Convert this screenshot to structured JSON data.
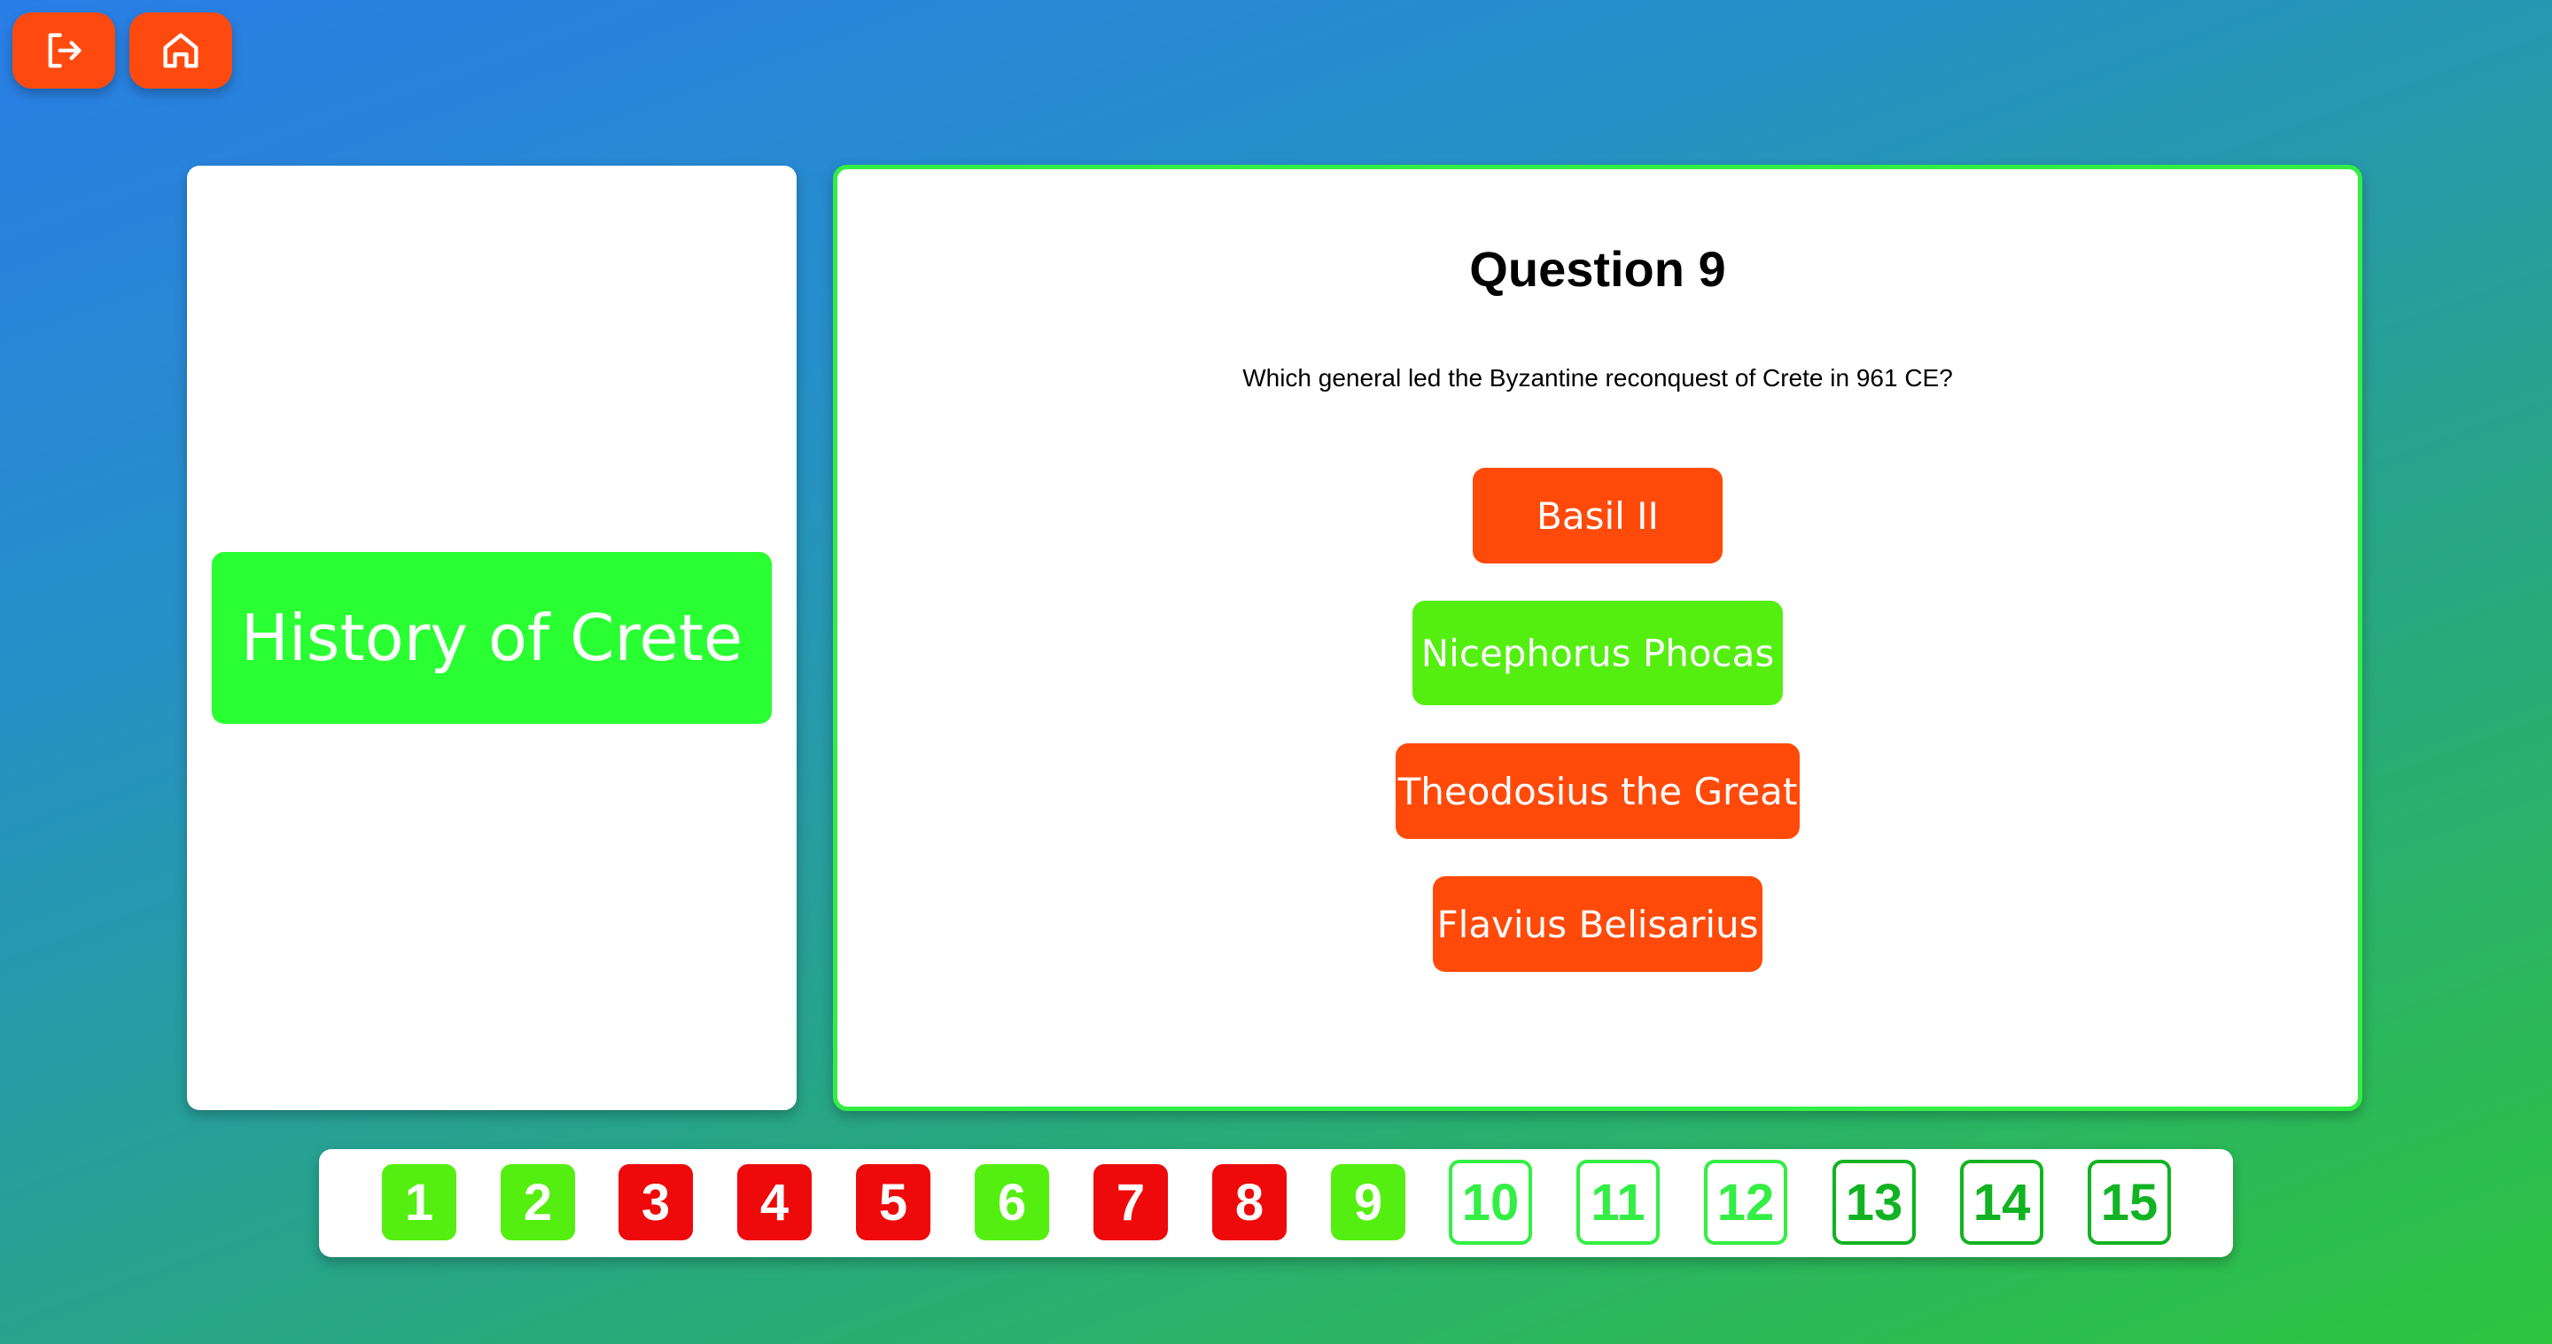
{
  "nav": {
    "exit_icon": "logout-icon",
    "home_icon": "home-icon"
  },
  "topic": {
    "title": "History of Crete"
  },
  "question": {
    "title": "Question 9",
    "text": "Which general led the Byzantine reconquest of Crete in 961 CE?",
    "answers": [
      {
        "label": "Basil II",
        "color": "#ff4a0a"
      },
      {
        "label": "Nicephorus Phocas",
        "color": "#55ee11"
      },
      {
        "label": "Theodosius the Great",
        "color": "#ff4a0a"
      },
      {
        "label": "Flavius Belisarius",
        "color": "#ff4a0a"
      }
    ]
  },
  "progress": {
    "items": [
      {
        "label": "1",
        "status": "correct"
      },
      {
        "label": "2",
        "status": "correct"
      },
      {
        "label": "3",
        "status": "wrong"
      },
      {
        "label": "4",
        "status": "wrong"
      },
      {
        "label": "5",
        "status": "wrong"
      },
      {
        "label": "6",
        "status": "correct"
      },
      {
        "label": "7",
        "status": "wrong"
      },
      {
        "label": "8",
        "status": "wrong"
      },
      {
        "label": "9",
        "status": "correct"
      },
      {
        "label": "10",
        "status": "unanswered"
      },
      {
        "label": "11",
        "status": "unanswered"
      },
      {
        "label": "12",
        "status": "unanswered"
      },
      {
        "label": "13",
        "status": "unanswered"
      },
      {
        "label": "14",
        "status": "unanswered"
      },
      {
        "label": "15",
        "status": "unanswered"
      }
    ]
  },
  "colors": {
    "accent_orange": "#ff4a0f",
    "correct_green": "#55ee11",
    "wrong_red": "#ee0a0a",
    "topic_green": "#29ff33",
    "outline_green_light": "#33ee44",
    "outline_green_dark": "#11b322"
  }
}
